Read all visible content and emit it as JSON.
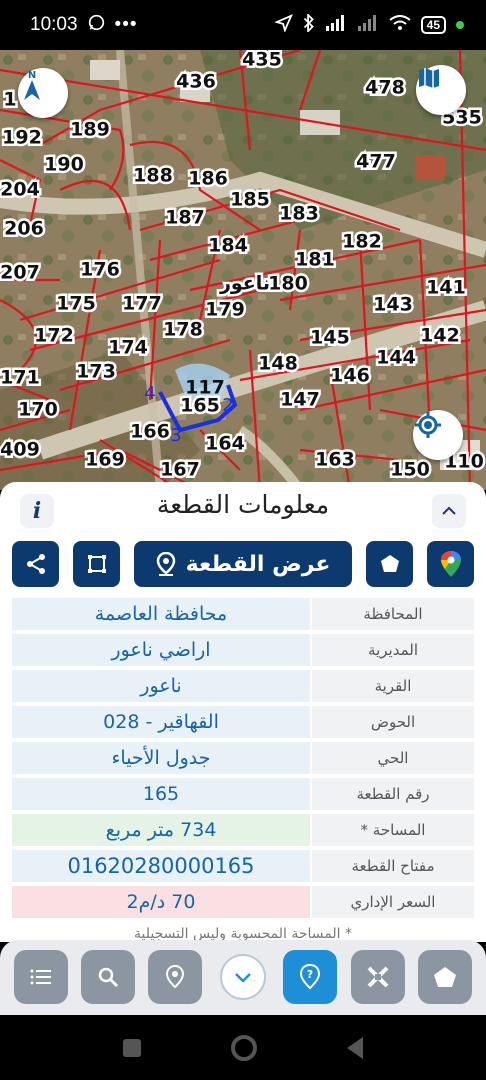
{
  "status_bar": {
    "time": "10:03",
    "battery": "45"
  },
  "map": {
    "village_label": "ناعور",
    "parcels": [
      "435",
      "436",
      "478",
      "535",
      "192",
      "189",
      "190",
      "477",
      "188",
      "186",
      "204",
      "185",
      "183",
      "206",
      "187",
      "184",
      "182",
      "181",
      "207",
      "176",
      "180",
      "141",
      "175",
      "177",
      "179",
      "143",
      "172",
      "178",
      "145",
      "142",
      "174",
      "173",
      "148",
      "144",
      "146",
      "171",
      "147",
      "170",
      "165",
      "166",
      "164",
      "409",
      "169",
      "167",
      "163",
      "150",
      "110",
      "1",
      "117"
    ],
    "vertex_labels": [
      "4",
      "2",
      "3"
    ],
    "icons": {
      "north": "compass-north-icon",
      "layers": "map-layers-icon",
      "locate": "my-location-icon"
    }
  },
  "panel": {
    "title": "معلومات القطعة",
    "show_button": "عرض القطعة",
    "rows": [
      {
        "label": "المحافظة",
        "value": "محافظة العاصمة"
      },
      {
        "label": "المديرية",
        "value": "اراضي ناعور"
      },
      {
        "label": "القرية",
        "value": "ناعور"
      },
      {
        "label": "الحوض",
        "value": "القهاقير - 028"
      },
      {
        "label": "الحي",
        "value": "جدول الأحياء"
      },
      {
        "label": "رقم القطعة",
        "value": "165"
      },
      {
        "label": "المساحة *",
        "value": "734  متر مربع"
      },
      {
        "label": "مفتاح القطعة",
        "value": "01620280000165"
      },
      {
        "label": "السعر الإداري",
        "value": "70 د/م2"
      }
    ],
    "footnote": "* المساحة المحسوبة وليس التسجيلية"
  },
  "toolbar": {
    "items": [
      "list-icon",
      "search-icon",
      "location-pin-icon",
      "chevron-down-icon",
      "help-pin-icon",
      "tools-icon",
      "home-icon"
    ],
    "active": "help-pin-icon"
  },
  "colors": {
    "accent": "#0d3a6e",
    "active": "#1e8fd6",
    "parcel_line": "#e0141e",
    "selected": "#1a2fe0"
  }
}
